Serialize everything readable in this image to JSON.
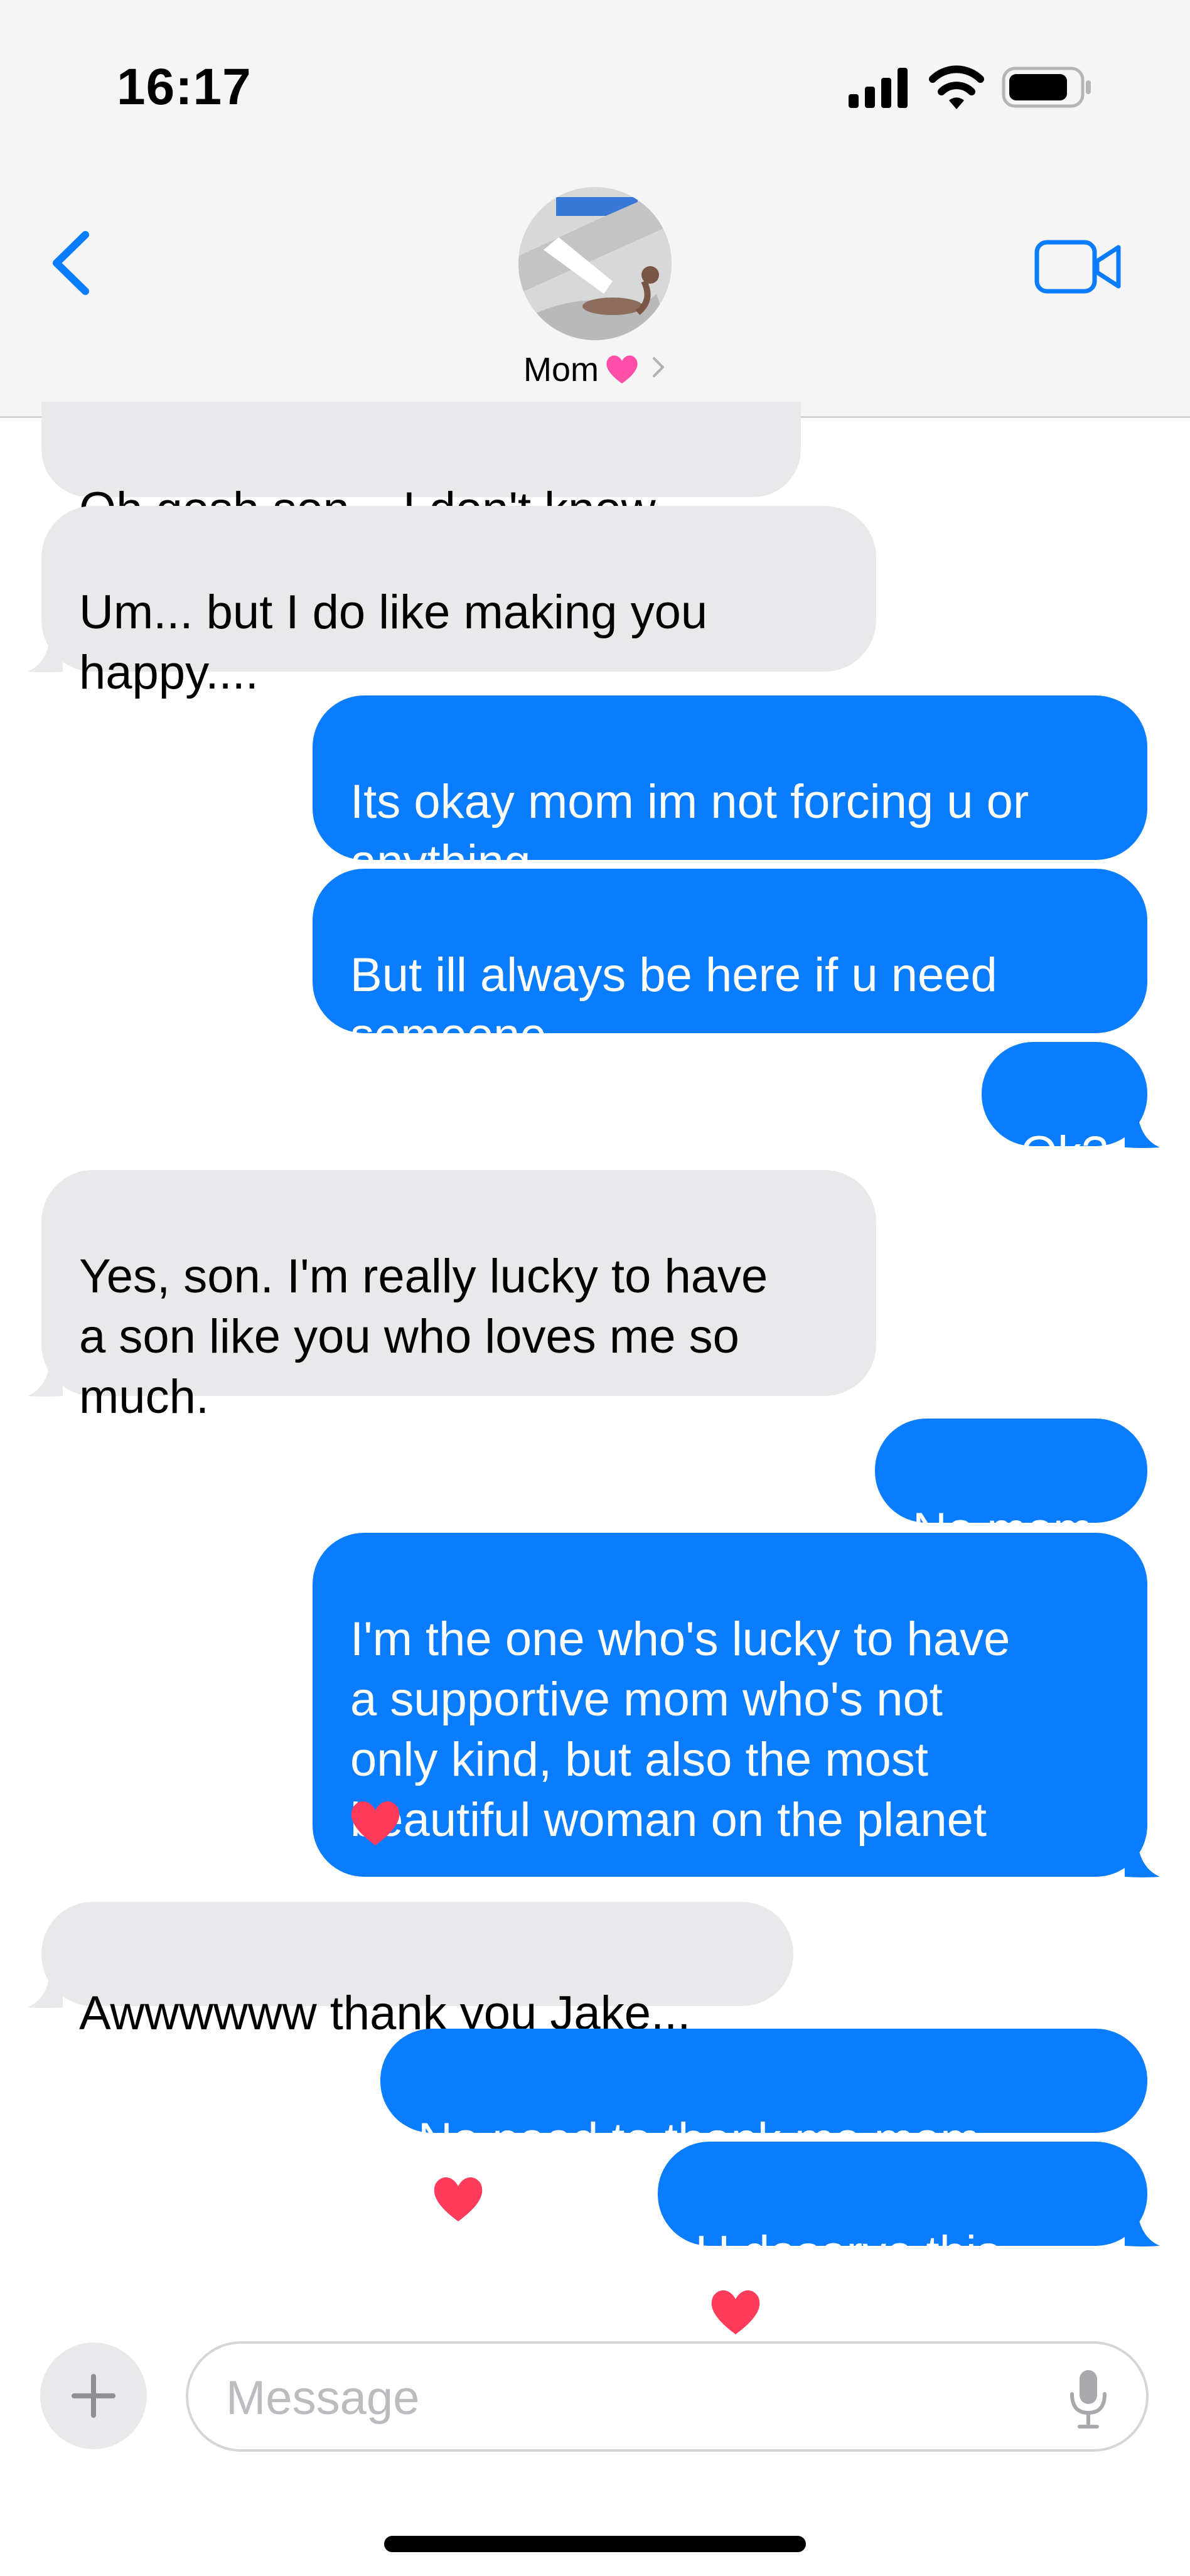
{
  "status_bar": {
    "time": "16:17"
  },
  "header": {
    "contact_name": "Mom"
  },
  "messages": [
    {
      "from": "them",
      "text": "Oh gosh son... I don't know...."
    },
    {
      "from": "them",
      "text": "Um... but I do like making you\nhappy...."
    },
    {
      "from": "me",
      "text": "Its okay mom im not forcing u or\nanything"
    },
    {
      "from": "me",
      "text": "But ill always be here if u need\nsomeone"
    },
    {
      "from": "me",
      "text": "Ok?"
    },
    {
      "from": "them",
      "text": "Yes, son. I'm really lucky to have\na son like you who loves me so\nmuch."
    },
    {
      "from": "me",
      "text": "No mom"
    },
    {
      "from": "me",
      "text": "I'm the one who's lucky to have\na supportive mom who's not\nonly kind, but also the most\nbeautiful woman on the planet"
    },
    {
      "from": "them",
      "text": "Awwwwww thank you Jake..."
    },
    {
      "from": "me",
      "text": "No need to thank me mom"
    },
    {
      "from": "me",
      "text": "U deserve this"
    }
  ],
  "composer": {
    "placeholder": "Message"
  },
  "colors": {
    "sent_bubble": "#0a7cff",
    "received_bubble": "#e9e9eb",
    "accent": "#0a7cff",
    "heart_pink": "#ff4fa8",
    "heart_red": "#ff3b5c"
  },
  "icons": [
    "back-chevron-icon",
    "video-camera-icon",
    "pink-heart-icon",
    "chevron-right-icon",
    "red-heart-icon",
    "plus-icon",
    "microphone-icon",
    "cellular-signal-icon",
    "wifi-icon",
    "battery-icon"
  ]
}
